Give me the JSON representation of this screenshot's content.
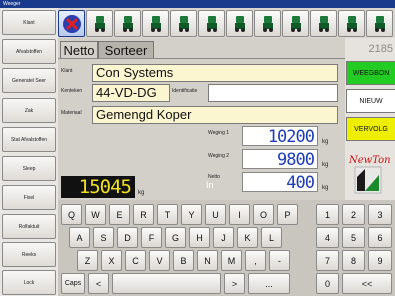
{
  "window": {
    "title": "Weeger"
  },
  "sidebar": {
    "buttons": [
      "Klant",
      "Afvalstoffen",
      "Generatel Seer",
      "Zak",
      "Stat Afvalstoffen",
      "Sleep",
      "Fixel",
      "Rolfaktuit",
      "Reeks",
      "Lock"
    ]
  },
  "toolbar": {
    "icons": [
      "cancel-icon",
      "truck-icon",
      "truck-icon",
      "truck-icon",
      "truck-icon",
      "truck-icon",
      "truck-icon",
      "truck-icon",
      "truck-icon",
      "truck-icon",
      "truck-icon",
      "truck-icon"
    ]
  },
  "tabs": {
    "netto": "Netto",
    "sorteer": "Sorteer"
  },
  "form": {
    "klant_label": "Klant",
    "klant_value": "Con Systems",
    "kenteken_label": "Kenteken",
    "kenteken_value": "44-VD-DG",
    "identificatie_label": "Identificatie",
    "identificatie_value": "",
    "materiaal_label": "Materiaal",
    "materiaal_value": "Gemengd Koper"
  },
  "weights": {
    "weging1_label": "Weging 1",
    "weging1_value": "10200",
    "weging2_label": "Weging 2",
    "weging2_value": "9800",
    "netto_label": "Netto",
    "netto_in_label": "In",
    "netto_value": "400",
    "unit": "kg",
    "scale_display": "15045",
    "scale_unit": "kg"
  },
  "right": {
    "ticket_number": "2185",
    "weegbon_label": "WEEGBON",
    "nieuw_label": "NIEUW",
    "vervolg_label": "VERVOLG",
    "logo_text": "NewTon"
  },
  "keyboard": {
    "row1": [
      "Q",
      "W",
      "E",
      "R",
      "T",
      "Y",
      "U",
      "I",
      "O",
      "P"
    ],
    "row2": [
      "A",
      "S",
      "D",
      "F",
      "G",
      "H",
      "J",
      "K",
      "L"
    ],
    "row3": [
      "Z",
      "X",
      "C",
      "V",
      "B",
      "N",
      "M",
      ",",
      "-"
    ],
    "row4": [
      "Caps",
      "<",
      "",
      ">",
      "..."
    ]
  },
  "numpad": {
    "keys": [
      "1",
      "2",
      "3",
      "4",
      "5",
      "6",
      "7",
      "8",
      "9",
      "0",
      "<<"
    ]
  },
  "colors": {
    "weegbon": "#22cc22",
    "nieuw": "#ffffff",
    "vervolg": "#eeee00",
    "weight_digits": "#1e3cb8",
    "lcd_digits": "#f0e020"
  }
}
